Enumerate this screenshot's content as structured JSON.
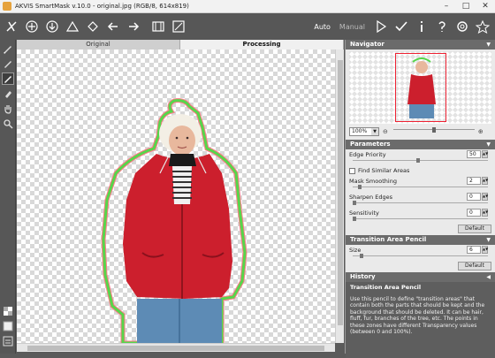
{
  "window": {
    "title": "AKVIS SmartMask v.10.0 - original.jpg (RGB/8, 614x819)"
  },
  "toolbar": {
    "auto_label": "Auto",
    "manual_label": "Manual"
  },
  "tabs": [
    {
      "label": "Original"
    },
    {
      "label": "Processing"
    }
  ],
  "navigator": {
    "title": "Navigator",
    "zoom": "100%"
  },
  "parameters": {
    "title": "Parameters",
    "edge_priority": {
      "label": "Edge Priority",
      "value": "50"
    },
    "find_similar": {
      "label": "Find Similar Areas"
    },
    "mask_smoothing": {
      "label": "Mask Smoothing",
      "value": "2"
    },
    "sharpen_edges": {
      "label": "Sharpen Edges",
      "value": "0"
    },
    "sensitivity": {
      "label": "Sensitivity",
      "value": "0"
    },
    "default_label": "Default"
  },
  "transition": {
    "title": "Transition Area Pencil",
    "size": {
      "label": "Size",
      "value": "6"
    },
    "default_label": "Default"
  },
  "history": {
    "title": "History"
  },
  "help": {
    "title": "Transition Area Pencil",
    "text": "Use this pencil to define \"transition areas\" that contain both the parts that should be kept and the background that should be deleted. It can be hair, fluff, fur, branches of the tree, etc. The points in these zones have different Transparency values (between 0 and 100%)."
  },
  "colors": {
    "accent": "#e23344",
    "panel_header": "#6b6b6b",
    "toolbar": "#575757"
  }
}
